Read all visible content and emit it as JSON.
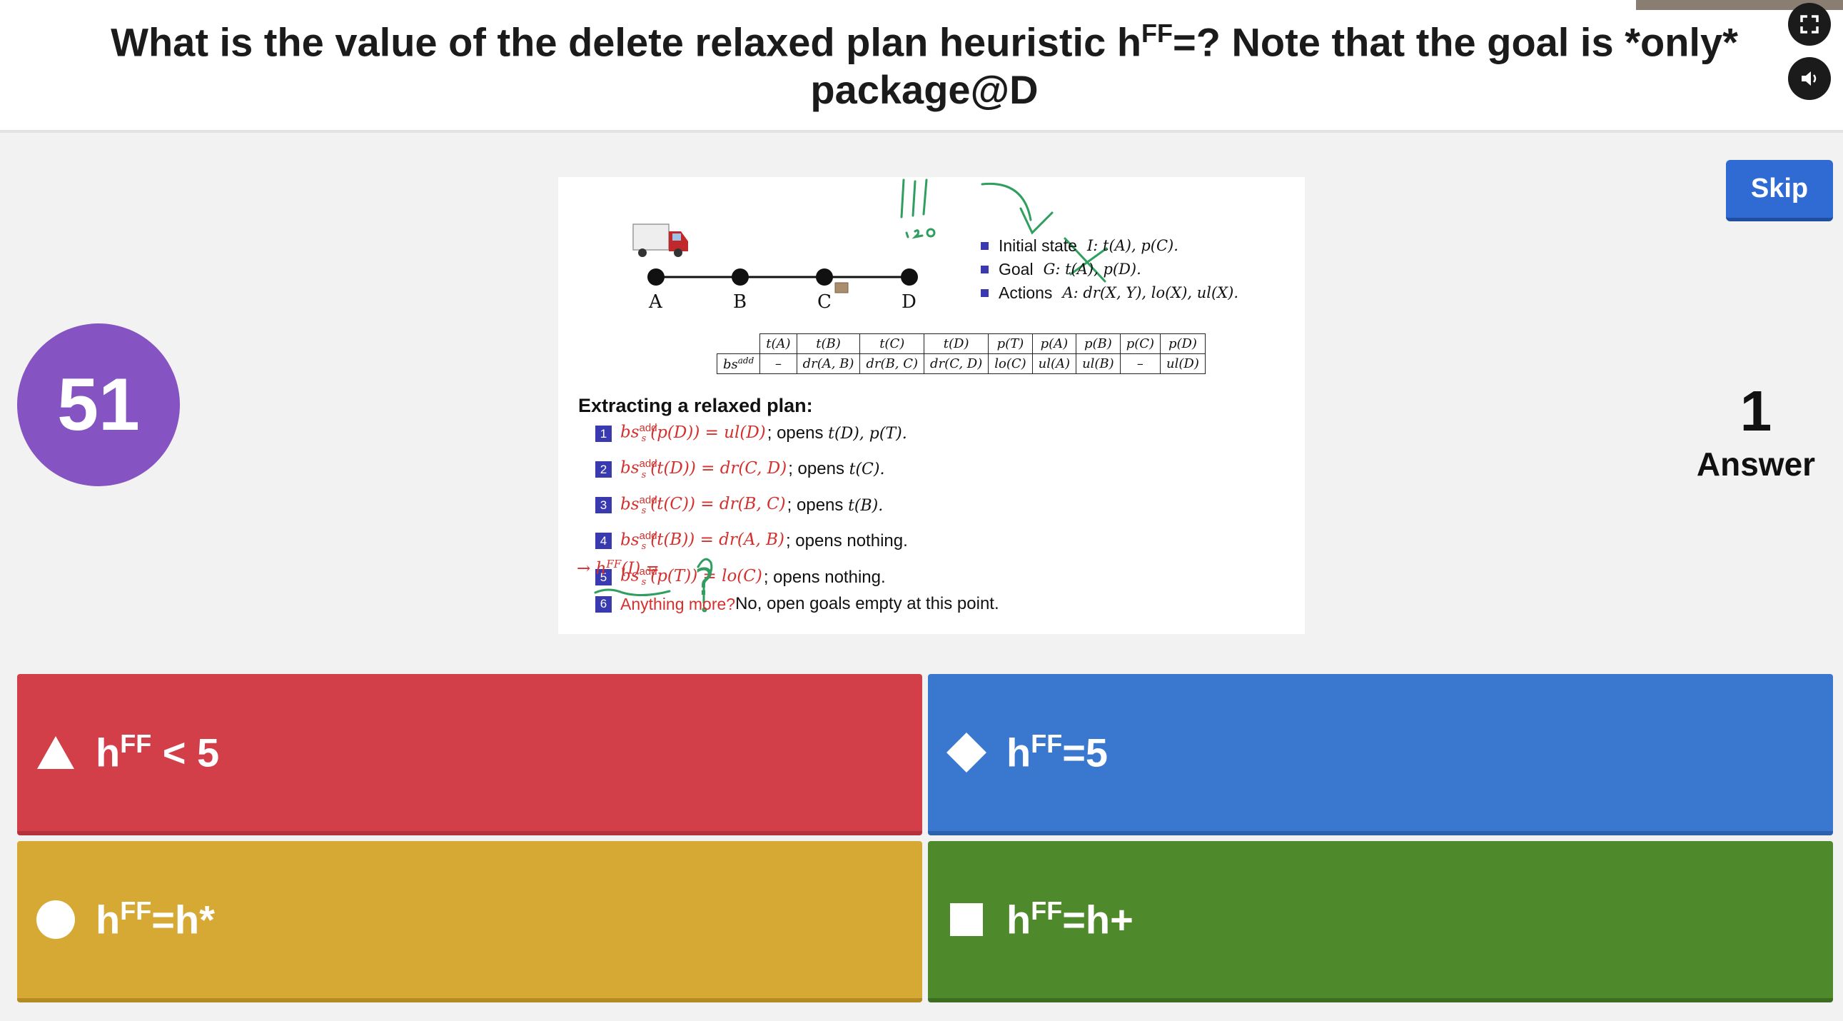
{
  "question": {
    "part1": "What is the value of the delete relaxed plan heuristic h",
    "sup": "FF",
    "part2": "=? Note that the goal is *only* package@D"
  },
  "controls": {
    "fullscreen_icon": "fullscreen-icon",
    "sound_icon": "speaker-icon",
    "skip_label": "Skip"
  },
  "counter": {
    "value": "51"
  },
  "answers": {
    "count": "1",
    "label": "Answer"
  },
  "slide": {
    "locations": [
      "A",
      "B",
      "C",
      "D"
    ],
    "bullets": [
      {
        "label": "Initial state ",
        "math": "I: t(A), p(C)."
      },
      {
        "label": "Goal ",
        "math": "G: t(A), p(D)."
      },
      {
        "label": "Actions ",
        "math": "A: dr(X, Y), lo(X), ul(X)."
      }
    ],
    "table": {
      "row_label": "bs",
      "row_label_sup": "add",
      "headers": [
        "t(A)",
        "t(B)",
        "t(C)",
        "t(D)",
        "p(T)",
        "p(A)",
        "p(B)",
        "p(C)",
        "p(D)"
      ],
      "values": [
        "–",
        "dr(A, B)",
        "dr(B, C)",
        "dr(C, D)",
        "lo(C)",
        "ul(A)",
        "ul(B)",
        "–",
        "ul(D)"
      ]
    },
    "extract_title": "Extracting a relaxed plan:",
    "steps": [
      {
        "n": "1",
        "expr": "bs",
        "sup": "add",
        "sub": "s",
        "arg": "(p(D)) = ul(D)",
        "rest": "; opens ",
        "rest_math": "t(D), p(T).",
        "kind": "math"
      },
      {
        "n": "2",
        "expr": "bs",
        "sup": "add",
        "sub": "s",
        "arg": "(t(D)) = dr(C, D)",
        "rest": "; opens ",
        "rest_math": "t(C).",
        "kind": "math"
      },
      {
        "n": "3",
        "expr": "bs",
        "sup": "add",
        "sub": "s",
        "arg": "(t(C)) = dr(B, C)",
        "rest": "; opens ",
        "rest_math": "t(B).",
        "kind": "math"
      },
      {
        "n": "4",
        "expr": "bs",
        "sup": "add",
        "sub": "s",
        "arg": "(t(B)) = dr(A, B)",
        "rest": "; opens nothing.",
        "rest_math": "",
        "kind": "math"
      },
      {
        "n": "5",
        "expr": "bs",
        "sup": "add",
        "sub": "s",
        "arg": "(p(T)) = lo(C)",
        "rest": "; opens nothing.",
        "rest_math": "",
        "kind": "math"
      },
      {
        "n": "6",
        "expr": "Anything more?",
        "sup": "",
        "sub": "",
        "arg": "",
        "rest": " No, open goals empty at this point.",
        "rest_math": "",
        "kind": "text"
      }
    ],
    "result": {
      "prefix": "→ h",
      "sup": "FF",
      "suffix": "(I) ="
    },
    "annotation_glyph": "?"
  },
  "options": [
    {
      "shape": "triangle-icon",
      "label_pre": "h",
      "label_sup": "FF",
      "label_post": " < 5",
      "color": "#d33f49"
    },
    {
      "shape": "diamond-icon",
      "label_pre": "h",
      "label_sup": "FF",
      "label_post": "=5",
      "color": "#3a78cf"
    },
    {
      "shape": "circle-icon",
      "label_pre": "h",
      "label_sup": "FF",
      "label_post": "=h*",
      "color": "#d6a934"
    },
    {
      "shape": "square-icon",
      "label_pre": "h",
      "label_sup": "FF",
      "label_post": "=h+",
      "color": "#4e8a2b"
    }
  ]
}
